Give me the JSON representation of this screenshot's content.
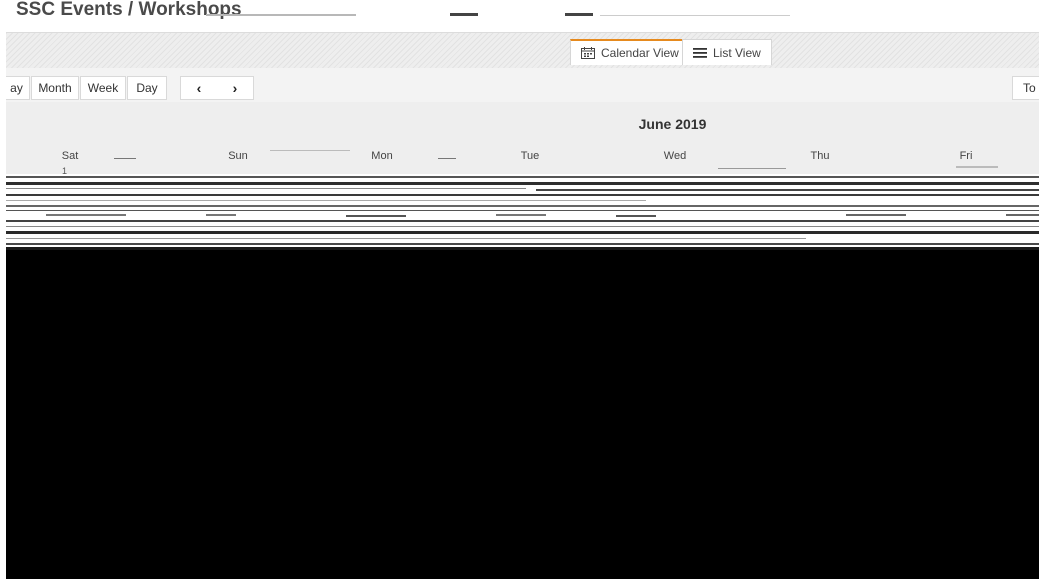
{
  "page": {
    "title": "SSC Events / Workshops"
  },
  "view_tabs": [
    {
      "label": "Calendar View",
      "icon": "calendar-icon",
      "active": true
    },
    {
      "label": "List View",
      "icon": "list-icon",
      "active": false
    }
  ],
  "toolbar": {
    "views": [
      "ay",
      "Month",
      "Week",
      "Day"
    ],
    "prev_icon": "‹",
    "next_icon": "›",
    "right_label": "To"
  },
  "calendar": {
    "month_title": "June 2019",
    "weekdays": [
      "Sat",
      "Sun",
      "Mon",
      "Tue",
      "Wed",
      "Thu",
      "Fri"
    ],
    "first_date": "1"
  },
  "colors": {
    "active_tab_accent": "#e68a1e",
    "header_bg": "#eeeeee",
    "toolbar_bg": "#f3f3f3"
  }
}
